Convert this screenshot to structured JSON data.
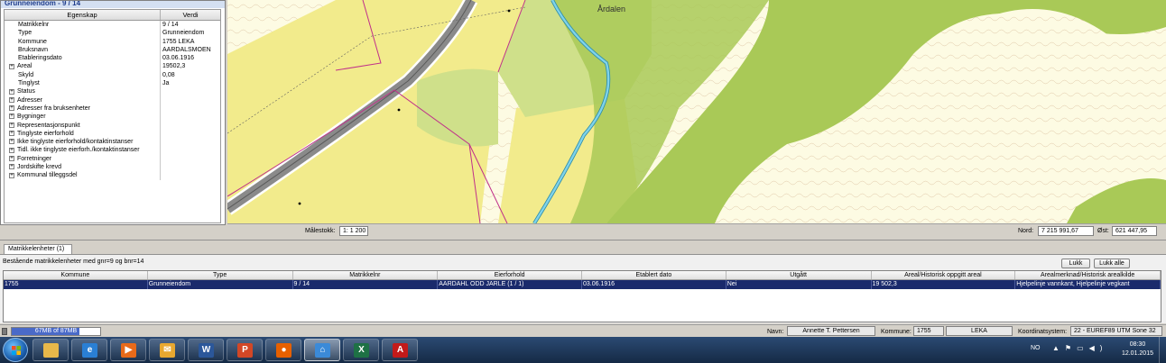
{
  "left_panel": {
    "title": "Grunneiendom - 9 / 14",
    "columns": {
      "property": "Egenskap",
      "value": "Verdi"
    },
    "rows": [
      {
        "key": "Matrikkelnr",
        "value": "9 / 14",
        "expandable": false
      },
      {
        "key": "Type",
        "value": "Grunneiendom",
        "expandable": false
      },
      {
        "key": "Kommune",
        "value": "1755  LEKA",
        "expandable": false
      },
      {
        "key": "Bruksnavn",
        "value": "AARDALSMOEN",
        "expandable": false
      },
      {
        "key": "Etableringsdato",
        "value": "03.06.1916",
        "expandable": false
      },
      {
        "key": "Areal",
        "value": "19502,3",
        "expandable": true
      },
      {
        "key": "Skyld",
        "value": "0,08",
        "expandable": false
      },
      {
        "key": "Tinglyst",
        "value": "Ja",
        "expandable": false
      },
      {
        "key": "Status",
        "value": "",
        "expandable": true
      },
      {
        "key": "Adresser",
        "value": "",
        "expandable": true
      },
      {
        "key": "Adresser fra bruksenheter",
        "value": "",
        "expandable": true
      },
      {
        "key": "Bygninger",
        "value": "",
        "expandable": true
      },
      {
        "key": "Representasjonspunkt",
        "value": "",
        "expandable": true
      },
      {
        "key": "Tinglyste eierforhold",
        "value": "",
        "expandable": true
      },
      {
        "key": "Ikke tinglyste eierforhold/kontaktinstanser",
        "value": "",
        "expandable": true
      },
      {
        "key": "Tidl. ikke tinglyste eierforh./kontaktinstanser",
        "value": "",
        "expandable": true
      },
      {
        "key": "Forretninger",
        "value": "",
        "expandable": true
      },
      {
        "key": "Jordskifte krevd",
        "value": "",
        "expandable": true
      },
      {
        "key": "Kommunal tilleggsdel",
        "value": "",
        "expandable": true
      }
    ],
    "expand_glyph": "+"
  },
  "map": {
    "place_label": "Årdalen",
    "colors": {
      "light_yellow": "#fdfbe3",
      "yellow": "#f2eb8c",
      "light_green": "#cfe08a",
      "green": "#a9c957",
      "water": "#7fd3ea",
      "road": "#8a8a8a",
      "boundary": "#c0308a",
      "contour": "#c79a72"
    }
  },
  "scale_bar": {
    "scale_label": "Målestokk:",
    "scale_value": "1: 1 200",
    "north_label": "Nord:",
    "north_value": "7 215 991,67",
    "east_label": "Øst:",
    "east_value": "621 447,95"
  },
  "bottom": {
    "tab_label": "Matrikkelenheter (1)",
    "result_label": "Bestående matrikkelenheter med gnr=9 og  bnr=14",
    "close_button": "Lukk",
    "close_all_button": "Lukk alle",
    "columns": [
      "Kommune",
      "Type",
      "Matrikkelnr",
      "Eierforhold",
      "Etablert dato",
      "Utgått",
      "Areal/Historisk oppgitt areal",
      "Arealmerknad/Historisk arealkilde"
    ],
    "rows": [
      [
        "1755",
        "Grunneiendom",
        "9 / 14",
        "AARDAHL ODD JARLE (1 / 1)",
        "03.06.1916",
        "Nei",
        "19 502,3",
        "Hjelpelinje vannkant, Hjelpelinje vegkant"
      ]
    ]
  },
  "status": {
    "memory_text": "67MB of 87MB",
    "memory_used_mb": 67,
    "memory_total_mb": 87,
    "user_label": "Navn:",
    "user_value": "Annette T. Pettersen",
    "kommune_label": "Kommune:",
    "kommune_number": "1755",
    "kommune_name": "LEKA",
    "crs_label": "Koordinatsystem:",
    "crs_value": "22 - EUREF89 UTM Sone 32"
  },
  "taskbar": {
    "apps": [
      {
        "name": "explorer",
        "icon": "folder-icon",
        "color": "#e8b84a",
        "glyph": ""
      },
      {
        "name": "internet-explorer",
        "icon": "ie-icon",
        "color": "#2a7fd4",
        "glyph": "e"
      },
      {
        "name": "media-player",
        "icon": "media-player-icon",
        "color": "#e86a1a",
        "glyph": "▶"
      },
      {
        "name": "outlook",
        "icon": "mail-icon",
        "color": "#e8a830",
        "glyph": "✉"
      },
      {
        "name": "word",
        "icon": "word-icon",
        "color": "#2b579a",
        "glyph": "W"
      },
      {
        "name": "powerpoint",
        "icon": "powerpoint-icon",
        "color": "#d24726",
        "glyph": "P"
      },
      {
        "name": "firefox",
        "icon": "firefox-icon",
        "color": "#e66000",
        "glyph": "●"
      },
      {
        "name": "gis-app",
        "icon": "house-icon",
        "color": "#3b8ad8",
        "glyph": "⌂"
      },
      {
        "name": "excel",
        "icon": "excel-icon",
        "color": "#1e7145",
        "glyph": "X"
      },
      {
        "name": "acrobat",
        "icon": "pdf-icon",
        "color": "#c21a1a",
        "glyph": "A"
      }
    ],
    "language": "NO",
    "tray_icons": [
      "▲",
      "⚑",
      "▭",
      "◀)"
    ],
    "time": "08:30",
    "date": "12.01.2015"
  }
}
